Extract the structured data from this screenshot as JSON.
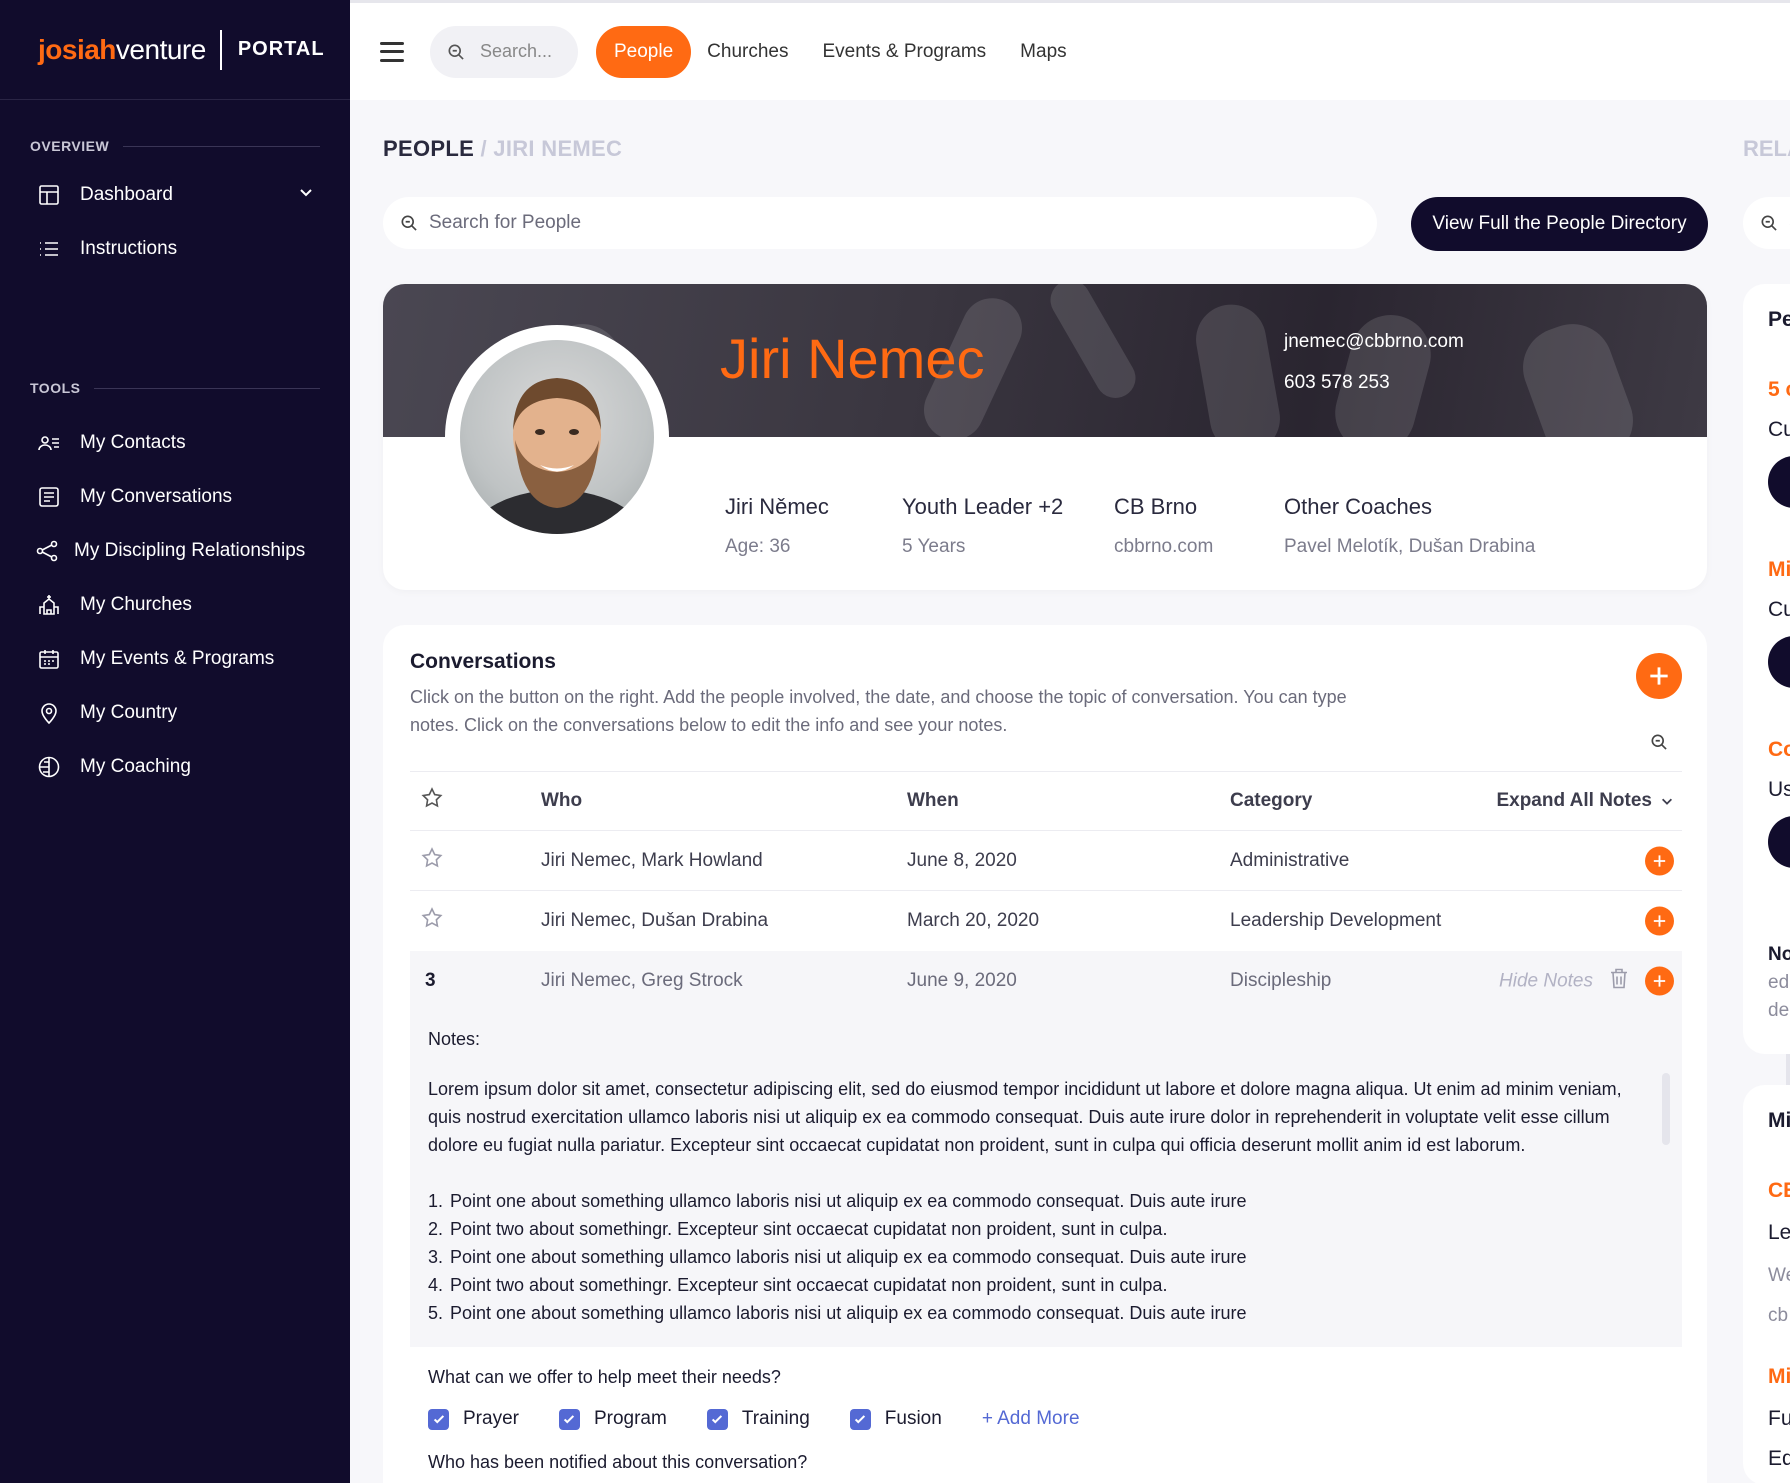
{
  "brand": {
    "logo_part1": "josiah",
    "logo_part2": "venture",
    "portal": "PORTAL"
  },
  "sidebar": {
    "overview_label": "OVERVIEW",
    "tools_label": "TOOLS",
    "overview_items": [
      {
        "label": "Dashboard",
        "icon": "dashboard-icon"
      },
      {
        "label": "Instructions",
        "icon": "list-icon"
      }
    ],
    "tools_items": [
      {
        "label": "My Contacts",
        "icon": "contacts-icon"
      },
      {
        "label": "My Conversations",
        "icon": "conversations-icon"
      },
      {
        "label": "My Discipling Relationships",
        "icon": "share-icon"
      },
      {
        "label": "My Churches",
        "icon": "church-icon"
      },
      {
        "label": "My Events & Programs",
        "icon": "calendar-icon"
      },
      {
        "label": "My Country",
        "icon": "location-icon"
      },
      {
        "label": "My Coaching",
        "icon": "coaching-icon"
      }
    ]
  },
  "topbar": {
    "search_placeholder": "Search...",
    "tabs": [
      "People",
      "Churches",
      "Events & Programs",
      "Maps"
    ],
    "active_tab": "People"
  },
  "breadcrumb": {
    "section": "PEOPLE",
    "separator": " / ",
    "current": "JIRI NEMEC"
  },
  "right_crumb": "RELA",
  "people_search": {
    "placeholder": "Search for People"
  },
  "directory_button": "View Full the People Directory",
  "profile": {
    "name": "Jiri Nemec",
    "email": "jnemec@cbbrno.com",
    "phone": "603 578 253",
    "full_name": "Jiri Němec",
    "age": "Age: 36",
    "role": "Youth Leader +2",
    "tenure": "5 Years",
    "church": "CB Brno",
    "church_site": "cbbrno.com",
    "coaches_label": "Other Coaches",
    "coaches": "Pavel Melotík, Dušan Drabina"
  },
  "conversations": {
    "title": "Conversations",
    "description": "Click on the button on the right. Add the people involved, the date, and choose the topic of conversation. You can type notes. Click on the conversations below to edit the info and see your notes.",
    "headers": {
      "who": "Who",
      "when": "When",
      "category": "Category",
      "expand": "Expand All Notes"
    },
    "rows": [
      {
        "who": "Jiri Nemec, Mark Howland",
        "when": "June 8, 2020",
        "category": "Administrative"
      },
      {
        "who": "Jiri Nemec, Dušan Drabina",
        "when": "March 20, 2020",
        "category": "Leadership Development"
      }
    ],
    "expanded": {
      "index": "3",
      "who": "Jiri Nemec, Greg Strock",
      "when": "June 9, 2020",
      "category": "Discipleship",
      "hide_label": "Hide Notes",
      "notes_label": "Notes:",
      "notes_body": "Lorem ipsum dolor sit amet, consectetur adipiscing elit, sed do eiusmod tempor incididunt ut labore et dolore magna aliqua. Ut enim ad minim veniam, quis nostrud exercitation ullamco laboris nisi ut aliquip ex ea commodo consequat. Duis aute irure dolor in reprehenderit in voluptate velit esse cillum dolore eu fugiat nulla pariatur. Excepteur sint occaecat cupidatat non proident, sunt in culpa qui officia deserunt mollit anim id est laborum.",
      "points": [
        {
          "n": "1.",
          "text": "Point one about something ullamco laboris nisi ut aliquip ex ea commodo consequat. Duis aute irure"
        },
        {
          "n": "2.",
          "text": "Point two about somethingr. Excepteur sint occaecat cupidatat non proident, sunt in culpa."
        },
        {
          "n": "3.",
          "text": "Point one about something ullamco laboris nisi ut aliquip ex ea commodo consequat. Duis aute irure"
        },
        {
          "n": "4.",
          "text": "Point two about somethingr. Excepteur sint occaecat cupidatat non proident, sunt in culpa."
        },
        {
          "n": "5.",
          "text": "Point one about something ullamco laboris nisi ut aliquip ex ea commodo consequat. Duis aute irure"
        }
      ]
    },
    "offer": {
      "question": "What can we offer to help meet their needs?",
      "options": [
        "Prayer",
        "Program",
        "Training",
        "Fusion"
      ],
      "add_more": "+ Add More",
      "question2": "Who has been notified about this conversation?"
    }
  },
  "right_panel": {
    "card1": [
      "Pe",
      "5 c",
      "Cu",
      "Mi",
      "Cu",
      "Co",
      "Us",
      "No",
      "ed",
      "de"
    ],
    "card2": [
      "Mi",
      "CE",
      "Le",
      "We",
      "cb",
      "Mi",
      "Fu",
      "Ed"
    ]
  },
  "colors": {
    "accent": "#ff6a13",
    "navy": "#110c2c",
    "check": "#5469d4"
  }
}
